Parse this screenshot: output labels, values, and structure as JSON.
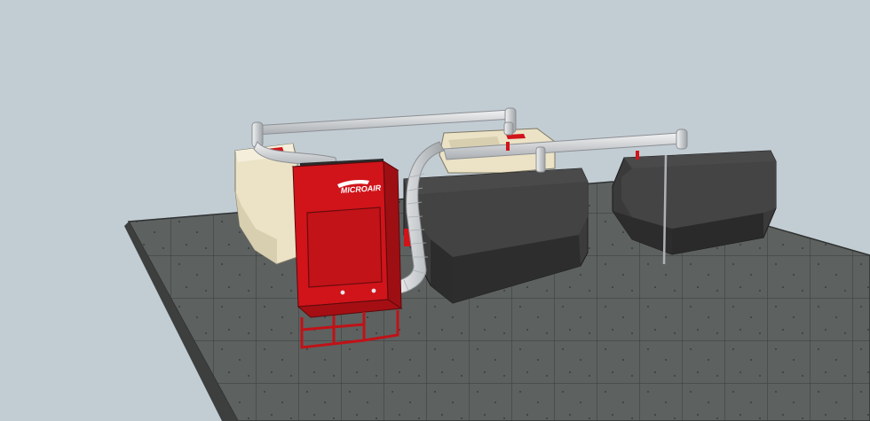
{
  "scene": {
    "background_color": "#c2ccd3",
    "floor_color": "#5a5e5c",
    "accent_color": "#d0141a",
    "machine_dark_color": "#3a3a3a",
    "machine_cream_color": "#ece3c6",
    "duct_color": "#d6d8da"
  },
  "collector": {
    "brand_text": "MICROAIR",
    "icon": "logo-swoosh-icon"
  }
}
